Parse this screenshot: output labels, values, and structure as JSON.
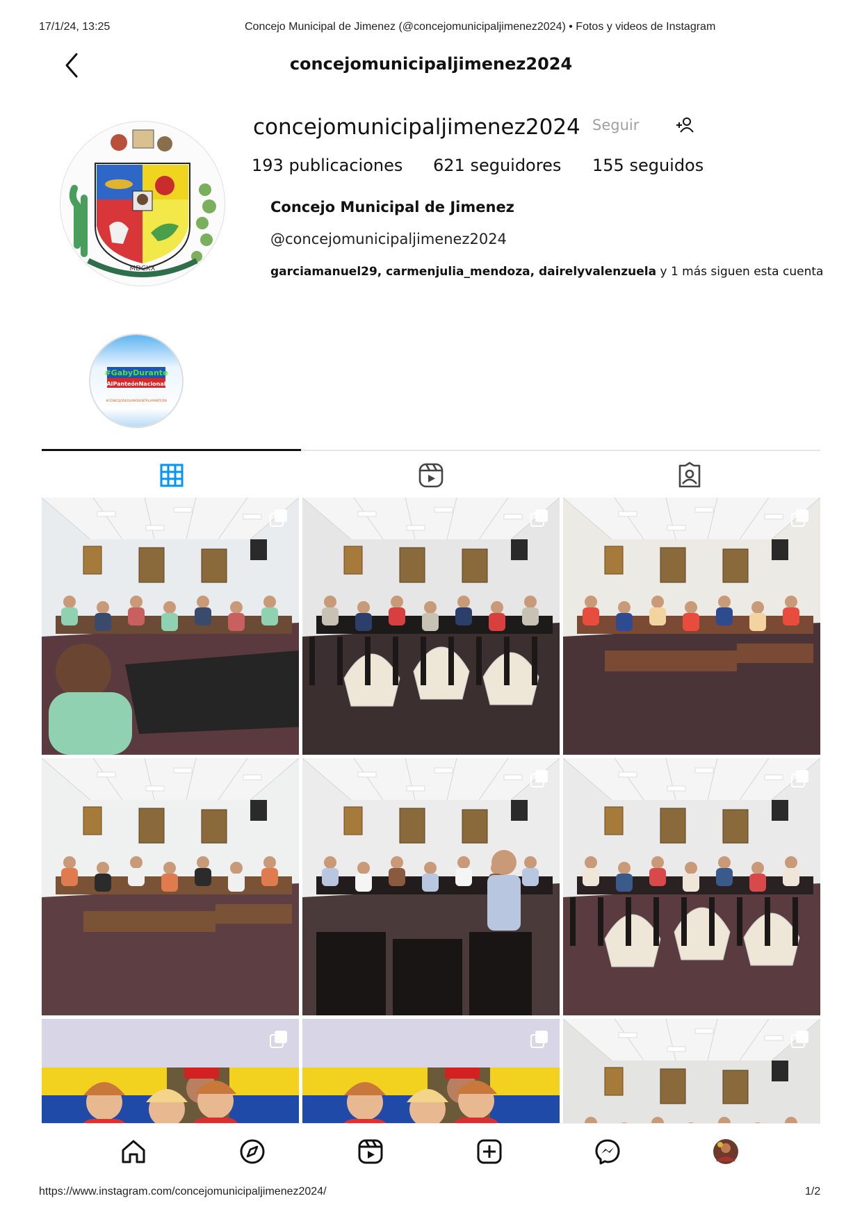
{
  "print_header": {
    "datetime": "17/1/24, 13:25",
    "page_title": "Concejo Municipal de Jimenez (@concejomunicipaljimenez2024) • Fotos y videos de Instagram"
  },
  "print_footer": {
    "url": "https://www.instagram.com/concejomunicipaljimenez2024/",
    "page": "1/2"
  },
  "top_bar": {
    "username": "concejomunicipaljimenez2024"
  },
  "profile": {
    "username": "concejomunicipaljimenez2024",
    "follow_label": "Seguir",
    "stats": {
      "posts_count": "193",
      "posts_label": " publicaciones",
      "followers_count": "621",
      "followers_label": " seguidores",
      "following_count": "155",
      "following_label": " seguidos"
    },
    "full_name": "Concejo Municipal de Jimenez",
    "handle": "@concejomunicipaljimenez2024",
    "followed_by": {
      "users": "garciamanuel29, carmenjulia_mendoza, dairelyvalenzuela",
      "suffix": " y 1 más siguen esta cuenta"
    },
    "avatar_seal_text": "MDCXX"
  },
  "highlight": {
    "title_line1": "#GabyDurante",
    "title_line2": "AlPanteónNacional",
    "caption": "#CONCEJOSEGUIMOSENTÁLAPANTEÓN"
  },
  "tabs": [
    {
      "icon": "grid-icon",
      "active": true
    },
    {
      "icon": "reels-icon",
      "active": false
    },
    {
      "icon": "tagged-icon",
      "active": false
    }
  ],
  "posts": [
    {
      "scene": "chamber-desk",
      "multi": true
    },
    {
      "scene": "chamber-chairs",
      "multi": true
    },
    {
      "scene": "chamber-meeting",
      "multi": true
    },
    {
      "scene": "chamber-wide",
      "multi": false
    },
    {
      "scene": "chamber-standing",
      "multi": true
    },
    {
      "scene": "chamber-rail",
      "multi": true
    },
    {
      "scene": "event-flags",
      "multi": true
    },
    {
      "scene": "event-flags",
      "multi": true
    },
    {
      "scene": "chamber-ceiling",
      "multi": true
    }
  ],
  "bottom_nav": [
    "home-icon",
    "explore-icon",
    "reels-icon",
    "create-icon",
    "messenger-icon",
    "profile-avatar"
  ],
  "colors": {
    "accent": "#0095f6",
    "text": "#111111",
    "muted": "#a0a0a0",
    "divider": "#e5e5e5"
  }
}
